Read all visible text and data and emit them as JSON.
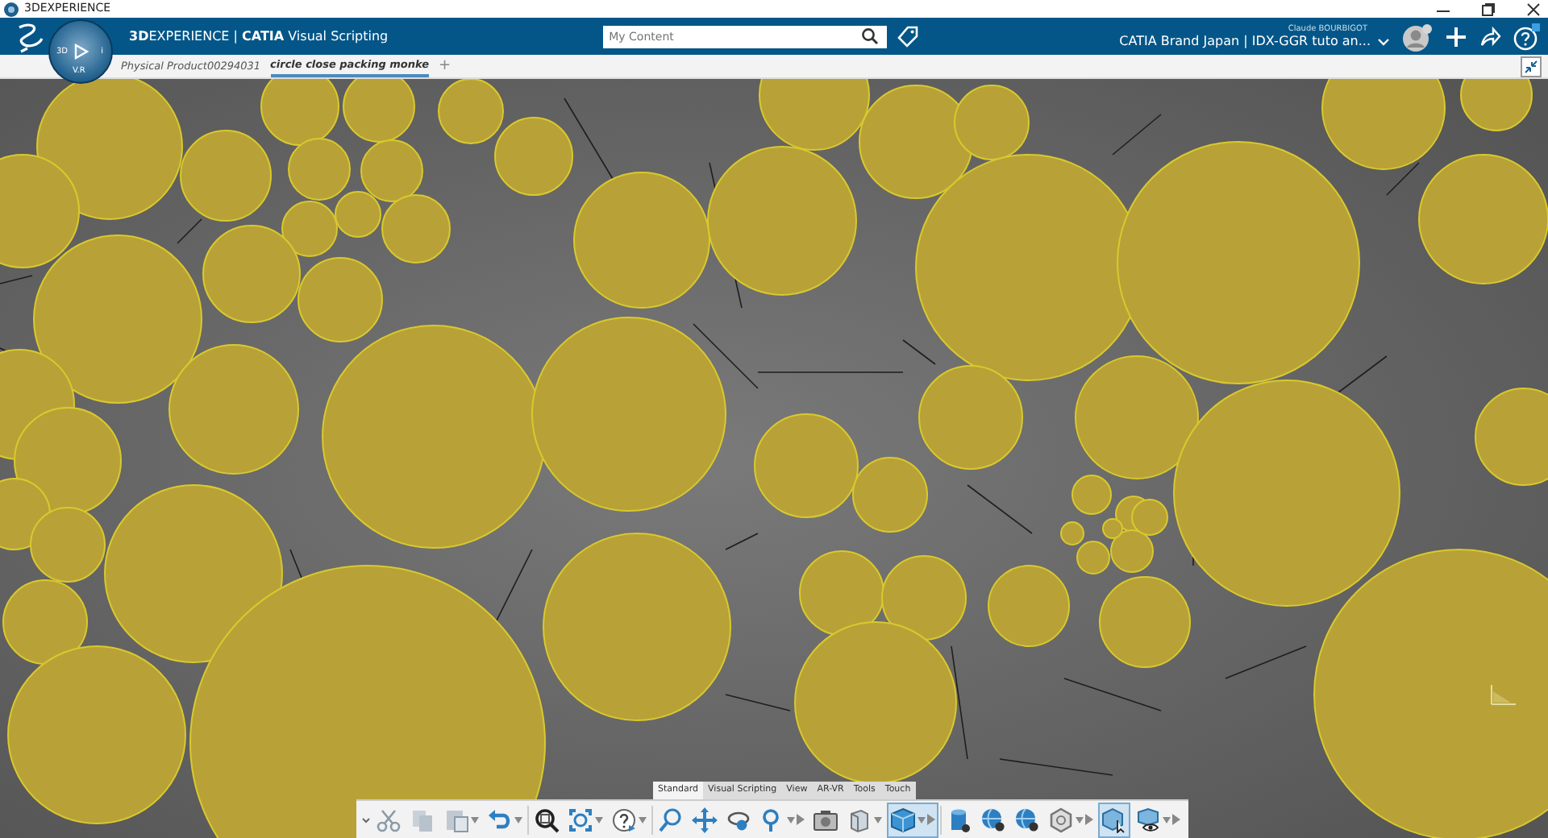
{
  "window": {
    "title": "3DEXPERIENCE"
  },
  "header": {
    "app_title": "**3D**EXPERIENCE | **CATIA** Visual Scripting",
    "compass_labels": [
      "3D",
      "V.R",
      "i"
    ],
    "search": {
      "placeholder": "My Content"
    },
    "user": "Claude BOURBIGOT",
    "context": "CATIA Brand Japan | IDX-GGR tuto an..."
  },
  "tabs": [
    {
      "label": "Physical Product00294031",
      "selected": false
    },
    {
      "label": "circle close packing monke",
      "selected": true
    }
  ],
  "add_tab": "+",
  "toolbar": {
    "tabs": [
      {
        "label": "Standard",
        "selected": true
      },
      {
        "label": "Visual Scripting",
        "selected": false
      },
      {
        "label": "View",
        "selected": false
      },
      {
        "label": "AR-VR",
        "selected": false
      },
      {
        "label": "Tools",
        "selected": false
      },
      {
        "label": "Touch",
        "selected": false
      }
    ],
    "buttons": [
      {
        "kind": "cut",
        "selected": false
      },
      {
        "kind": "copy",
        "selected": false
      },
      {
        "kind": "paste",
        "selected": false
      },
      {
        "kind": "undo",
        "selected": false
      },
      {
        "kind": "separator"
      },
      {
        "kind": "zoom-area",
        "selected": false
      },
      {
        "kind": "fit",
        "selected": false
      },
      {
        "kind": "help",
        "selected": false
      },
      {
        "kind": "separator"
      },
      {
        "kind": "zoom",
        "selected": false
      },
      {
        "kind": "pan",
        "selected": false
      },
      {
        "kind": "rotate",
        "selected": false
      },
      {
        "kind": "magnify",
        "selected": false
      },
      {
        "kind": "camera",
        "selected": false
      },
      {
        "kind": "box",
        "selected": false
      },
      {
        "kind": "cube",
        "selected": true
      },
      {
        "kind": "separator"
      },
      {
        "kind": "cylinder",
        "selected": false
      },
      {
        "kind": "sphere",
        "selected": false
      },
      {
        "kind": "sphere",
        "selected": false
      },
      {
        "kind": "hexagon",
        "selected": false
      },
      {
        "kind": "select",
        "selected": true
      },
      {
        "kind": "eye",
        "selected": false
      }
    ]
  }
}
